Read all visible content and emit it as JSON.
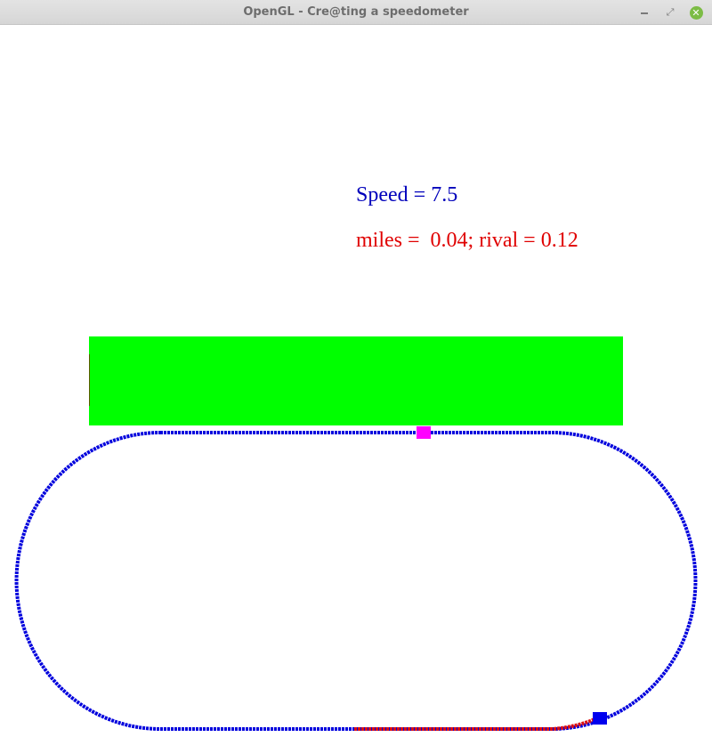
{
  "window": {
    "title": "OpenGL - Cre@ting a speedometer"
  },
  "hud": {
    "speed_text": "Speed = 7.5",
    "miles_text": "miles =  0.04; rival = 0.12",
    "speed_color": "#0000bb",
    "miles_color": "#e00000"
  },
  "speedometer_bar": {
    "color": "#00ff00"
  },
  "track": {
    "shape": "stadium oval, dotted",
    "color": "#0000dd",
    "traveled_color": "#dd1111",
    "player_marker_color": "#0000ee",
    "rival_marker_color": "#ff00ff"
  }
}
